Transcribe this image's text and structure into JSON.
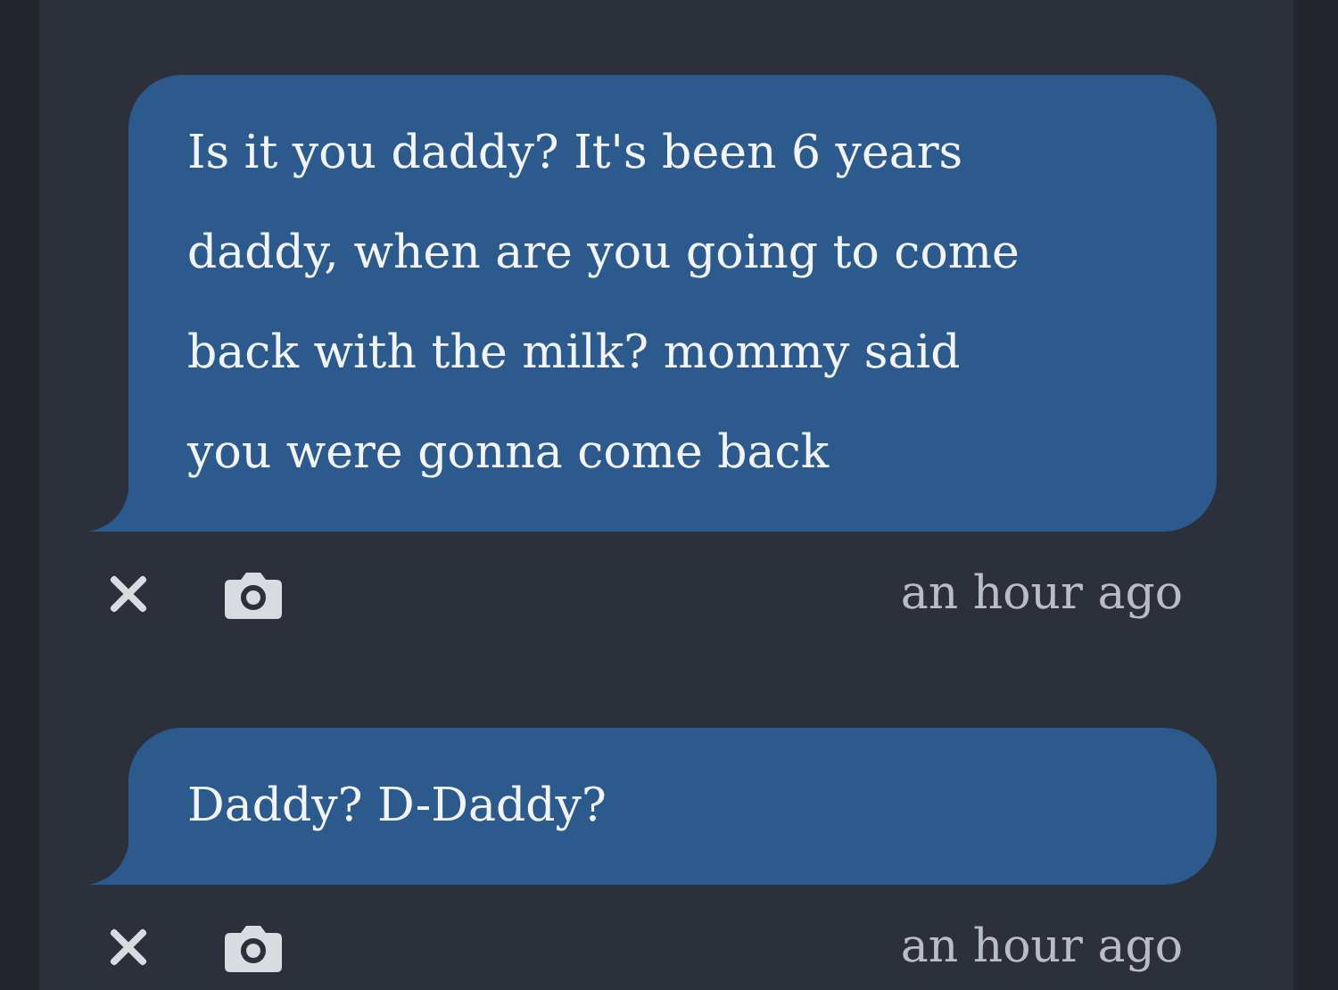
{
  "messages": [
    {
      "lines": [
        "Is it you daddy? It's been 6 years",
        "daddy, when are you going to come",
        "back with the milk? mommy said",
        "you were gonna come back"
      ],
      "time": "an hour ago"
    },
    {
      "lines": [
        "Daddy? D-Daddy?"
      ],
      "time": "an hour ago"
    }
  ]
}
